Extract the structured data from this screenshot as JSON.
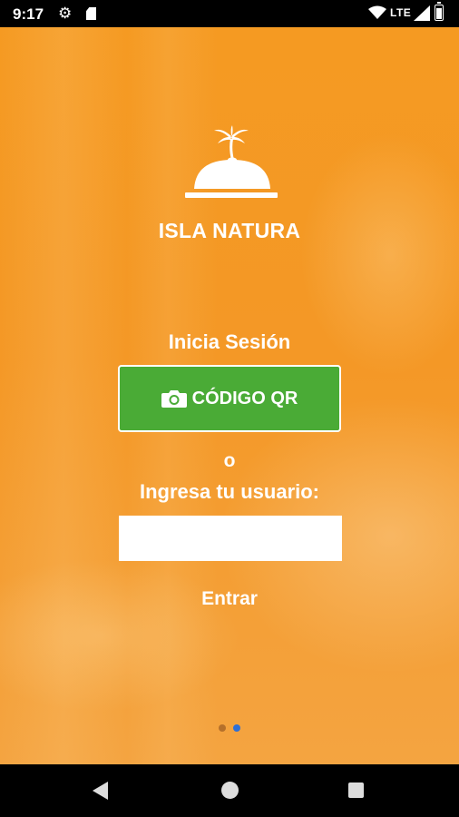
{
  "status_bar": {
    "time": "9:17",
    "network": "LTE",
    "icons": [
      "gear-icon",
      "sd-card-icon",
      "wifi-icon",
      "signal-icon",
      "battery-icon"
    ]
  },
  "app": {
    "name": "ISLA NATURA",
    "logo_icon": "cloche-palm-logo",
    "accent_color": "#f59a22",
    "button_color": "#4aab36"
  },
  "login": {
    "title": "Inicia Sesión",
    "qr_button_label": "CÓDIGO QR",
    "qr_button_icon": "camera-icon",
    "or_text": "o",
    "user_prompt": "Ingresa tu usuario:",
    "user_input_value": "",
    "user_input_placeholder": "",
    "enter_label": "Entrar"
  },
  "pager": {
    "pages": 2,
    "active_index": 1
  },
  "nav_bar": {
    "icons": [
      "back-icon",
      "home-icon",
      "recents-icon"
    ]
  }
}
